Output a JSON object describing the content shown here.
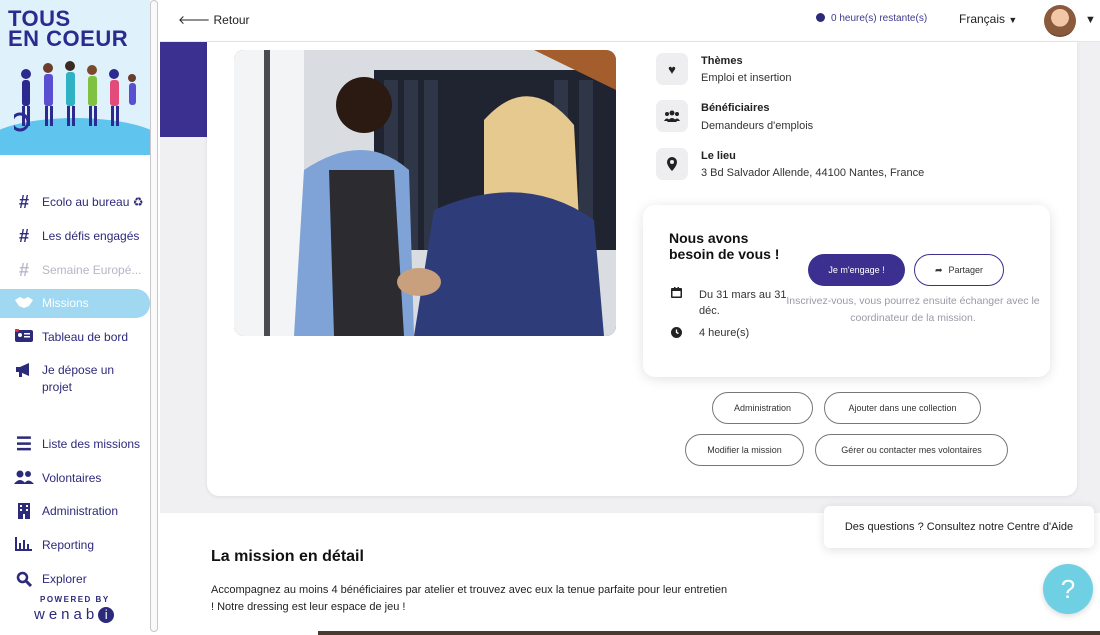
{
  "logo": {
    "line1": "TOUS",
    "line2": "EN COEUR"
  },
  "sidebar": {
    "items": [
      {
        "label": "Ecolo au bureau ♻",
        "icon": "hashtag-icon"
      },
      {
        "label": "Les défis engagés",
        "icon": "hashtag-icon"
      },
      {
        "label": "Semaine Europé...",
        "icon": "hashtag-icon"
      },
      {
        "label": "Missions",
        "icon": "handshake-icon"
      },
      {
        "label": "Tableau de bord",
        "icon": "id-card-icon"
      },
      {
        "label": "Je dépose un projet",
        "icon": "megaphone-icon"
      },
      {
        "label": "Liste des missions",
        "icon": "list-icon"
      },
      {
        "label": "Volontaires",
        "icon": "users-icon"
      },
      {
        "label": "Administration",
        "icon": "building-icon"
      },
      {
        "label": "Reporting",
        "icon": "chart-icon"
      },
      {
        "label": "Explorer",
        "icon": "search-icon"
      }
    ],
    "powered_by": "POWERED BY",
    "brand_pre": "wenab",
    "brand_dot": "i"
  },
  "topbar": {
    "back_label": "Retour",
    "hours_label": "0 heure(s) restante(s)",
    "language": "Français"
  },
  "mission": {
    "themes_title": "Thèmes",
    "themes_value": "Emploi et insertion",
    "beneficiaries_title": "Bénéficiaires",
    "beneficiaries_value": "Demandeurs d'emplois",
    "place_title": "Le lieu",
    "place_value": "3 Bd Salvador Allende, 44100 Nantes, France"
  },
  "engage": {
    "heading": "Nous avons besoin de vous !",
    "date": "Du 31 mars au 31 déc.",
    "duration": "4 heure(s)",
    "engage_button": "Je m'engage !",
    "share_button": "Partager",
    "hint": "Inscrivez-vous, vous pourrez ensuite échanger avec le coordinateur de la mission."
  },
  "actions": {
    "administration": "Administration",
    "add_collection": "Ajouter dans une collection",
    "edit_mission": "Modifier la mission",
    "manage_volunteers": "Gérer ou contacter mes volontaires"
  },
  "detail": {
    "title": "La mission en détail",
    "text": "Accompagnez au moins 4 bénéficiaires par atelier et trouvez avec eux la tenue parfaite pour leur entretien ! Notre dressing est leur espace de jeu !"
  },
  "help": {
    "text": "Des questions ? Consultez notre Centre d'Aide",
    "button": "?"
  },
  "colors": {
    "brand": "#3b2f8f",
    "active_nav": "#9fd8f0",
    "help_button": "#6fcfe3"
  }
}
